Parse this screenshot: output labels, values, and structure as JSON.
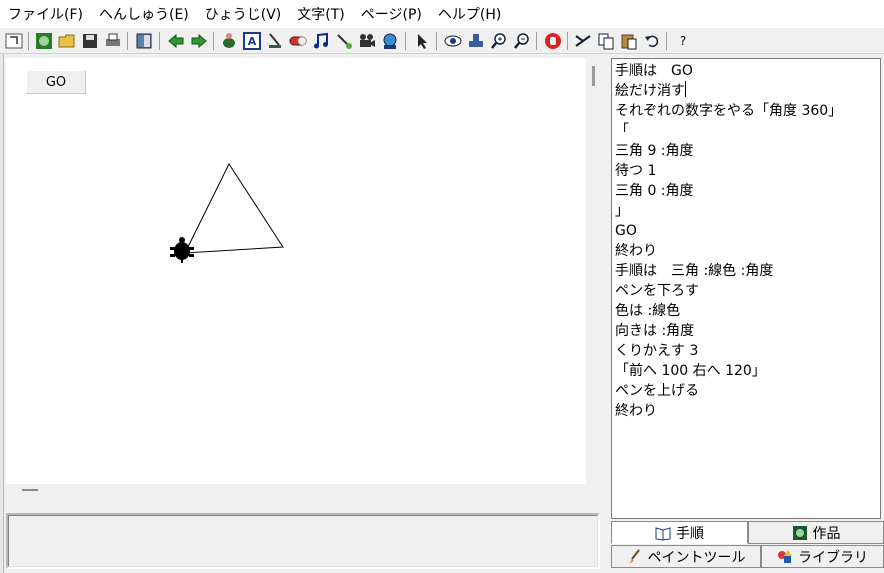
{
  "menu": {
    "items": [
      "ファイル(F)",
      "へんしゅう(E)",
      "ひょうじ(V)",
      "文字(T)",
      "ページ(P)",
      "ヘルプ(H)"
    ]
  },
  "toolbar": {
    "help_glyph": "?"
  },
  "canvas": {
    "go_button_label": "GO"
  },
  "editor": {
    "lines": [
      "手順は　GO",
      "絵だけ消す",
      "それぞれの数字をやる「角度 360」",
      "「",
      "三角 9 :角度",
      "待つ 1",
      "三角 0 :角度",
      "」",
      "GO",
      "終わり",
      "手順は　三角 :線色 :角度",
      "ペンを下ろす",
      "色は :線色",
      "向きは :角度",
      "くりかえす 3",
      "「前へ 100 右へ 120」",
      "ペンを上げる",
      "終わり"
    ]
  },
  "tabs": {
    "procedure": "手順",
    "works": "作品",
    "paint_tool": "ペイントツール",
    "library": "ライブラリ"
  }
}
